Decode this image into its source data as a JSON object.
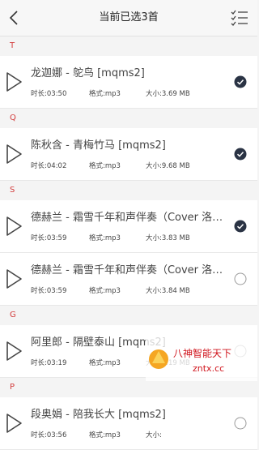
{
  "header": {
    "title": "当前已选3首"
  },
  "labels": {
    "duration": "时长:",
    "format": "格式:",
    "size": "大小:"
  },
  "colors": {
    "accent": "#d23b3b",
    "checked": "#2a3344",
    "unchecked_border": "#9a9a9a"
  },
  "sections": [
    {
      "letter": "T",
      "songs": [
        {
          "title": "龙迦娜 - 鸵鸟 [mqms2]",
          "duration": "03:50",
          "format": "mp3",
          "size": "3.69 MB",
          "selected": true
        }
      ]
    },
    {
      "letter": "Q",
      "songs": [
        {
          "title": "陈秋含 - 青梅竹马 [mqms2]",
          "duration": "04:02",
          "format": "mp3",
          "size": "9.68 MB",
          "selected": true
        }
      ]
    },
    {
      "letter": "S",
      "songs": [
        {
          "title": "德赫兰 - 霜雪千年和声伴奏（Cover 洛…",
          "duration": "03:59",
          "format": "mp3",
          "size": "3.83 MB",
          "selected": true
        },
        {
          "title": "德赫兰 - 霜雪千年和声伴奏（Cover 洛…",
          "duration": "03:59",
          "format": "mp3",
          "size": "3.84 MB",
          "selected": false
        }
      ]
    },
    {
      "letter": "G",
      "songs": [
        {
          "title": "阿里郎 - 隔壁泰山 [mqms2]",
          "duration": "03:19",
          "format": "mp3",
          "size": "3.19 MB",
          "selected": false
        }
      ]
    },
    {
      "letter": "P",
      "songs": [
        {
          "title": "段奥娟 - 陪我长大 [mqms2]",
          "duration": "03:56",
          "format": "mp3",
          "size": "",
          "selected": false
        }
      ]
    }
  ],
  "watermark": {
    "line1": "八神智能天下",
    "line2": "zntx.cc"
  }
}
